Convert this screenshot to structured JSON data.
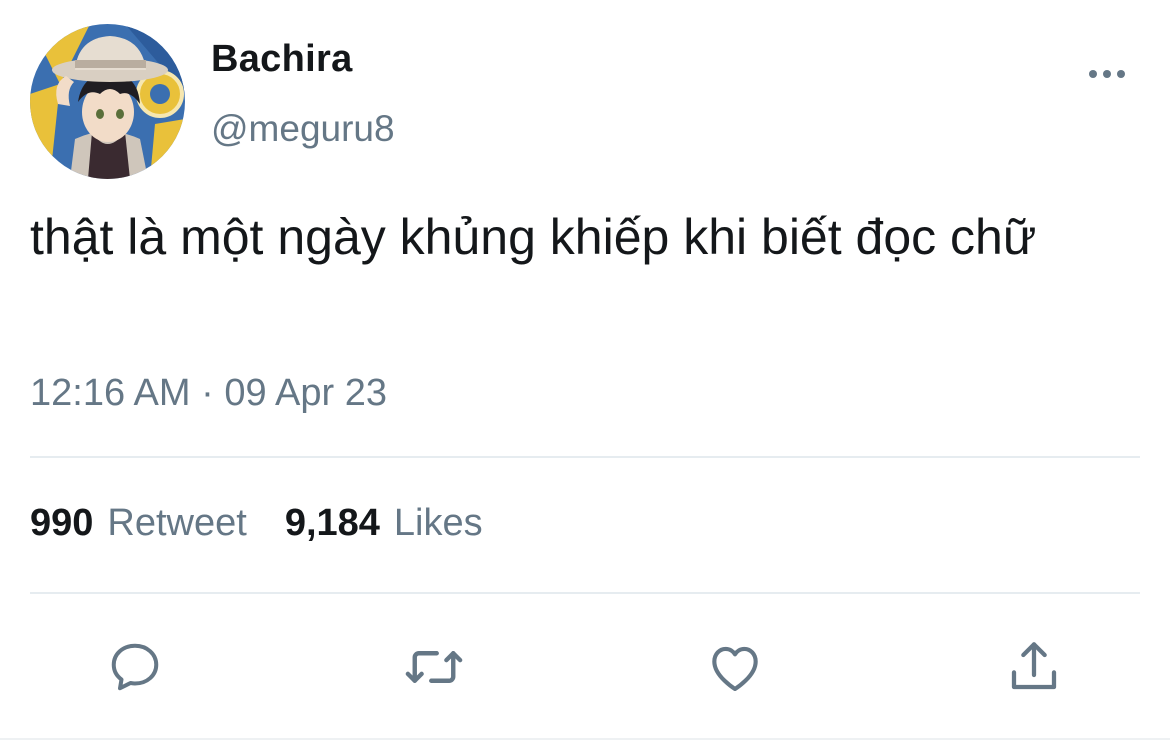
{
  "user": {
    "display_name": "Bachira",
    "handle": "@meguru8",
    "avatar_icon": "avatar-illustration"
  },
  "tweet": {
    "text": "thật là một ngày khủng khiếp khi biết đọc chữ",
    "timestamp": "12:16 AM · 09 Apr 23"
  },
  "stats": {
    "retweets_count": "990",
    "retweets_label": "Retweet",
    "likes_count": "9,184",
    "likes_label": "Likes"
  },
  "actions": {
    "reply_icon": "comment-icon",
    "retweet_icon": "retweet-icon",
    "like_icon": "heart-icon",
    "share_icon": "share-icon"
  },
  "colors": {
    "primary_text": "#14171a",
    "secondary_text": "#657786",
    "divider": "#e6ecf0"
  }
}
